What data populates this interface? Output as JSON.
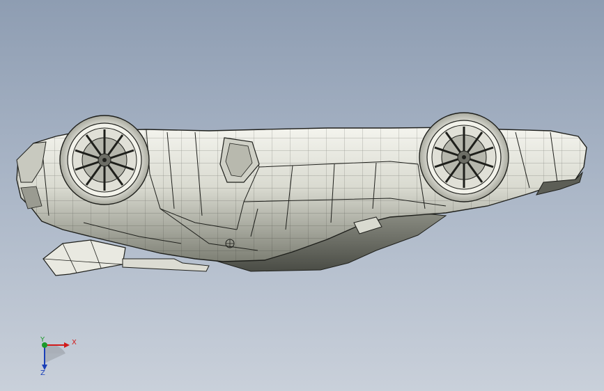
{
  "viewport": {
    "background_top": "#8e9db2",
    "background_bottom": "#c9d0da",
    "model": "car-body-upside-down-wireframe"
  },
  "triad": {
    "x_label": "X",
    "y_label": "Y",
    "z_label": "Z",
    "x_color": "#d11a1a",
    "y_color": "#1c9a2a",
    "z_color": "#1a3fb8"
  }
}
